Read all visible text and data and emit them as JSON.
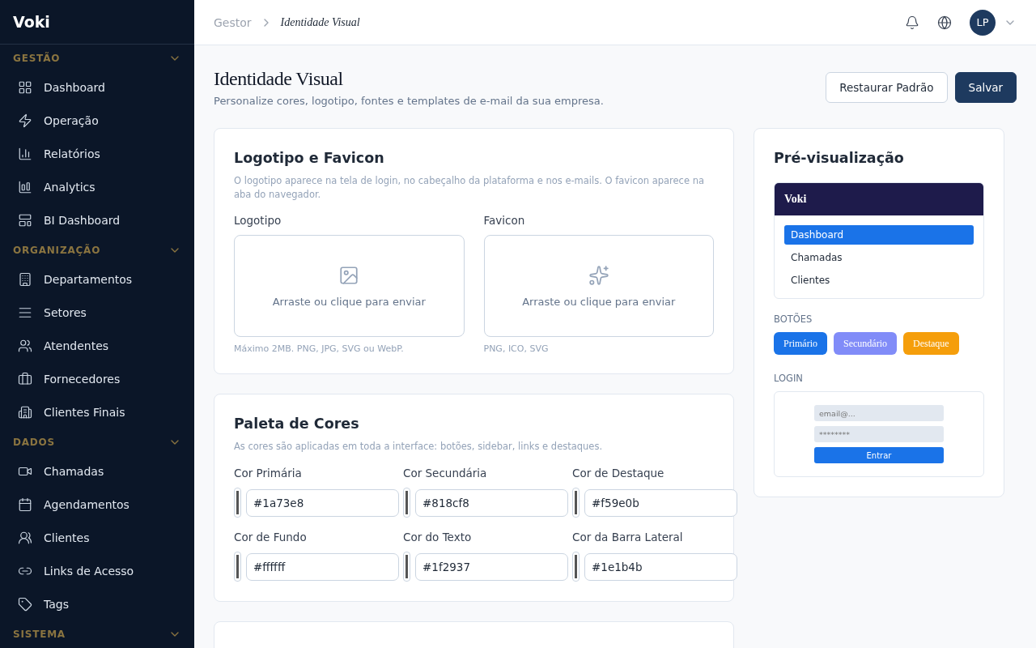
{
  "sidebar": {
    "brand": "Voki",
    "sections": [
      {
        "title": "GESTÃO",
        "expanded": true,
        "items": [
          {
            "label": "Dashboard"
          },
          {
            "label": "Operação"
          },
          {
            "label": "Relatórios"
          },
          {
            "label": "Analytics"
          },
          {
            "label": "BI Dashboard"
          }
        ]
      },
      {
        "title": "ORGANIZAÇÃO",
        "expanded": true,
        "items": [
          {
            "label": "Departamentos"
          },
          {
            "label": "Setores"
          },
          {
            "label": "Atendentes"
          },
          {
            "label": "Fornecedores"
          },
          {
            "label": "Clientes Finais"
          }
        ]
      },
      {
        "title": "DADOS",
        "expanded": true,
        "items": [
          {
            "label": "Chamadas"
          },
          {
            "label": "Agendamentos"
          },
          {
            "label": "Clientes"
          },
          {
            "label": "Links de Acesso"
          },
          {
            "label": "Tags"
          }
        ]
      },
      {
        "title": "SISTEMA",
        "expanded": true
      }
    ]
  },
  "breadcrumb": [
    "Gestor",
    "Identidade Visual"
  ],
  "user": {
    "initials": "LP"
  },
  "page": {
    "title": "Identidade Visual",
    "subtitle": "Personalize cores, logotipo, fontes e templates de e-mail da sua empresa.",
    "buttons": [
      {
        "label": "Restaurar Padrão",
        "kind": "secondary"
      },
      {
        "label": "Salvar",
        "kind": "primary"
      }
    ]
  },
  "logo_card": {
    "title": "Logotipo e Favicon",
    "description": "O logotipo aparece na tela de login, no cabeçalho da plataforma e nos e-mails. O favicon aparece na aba do navegador.",
    "uploads": [
      {
        "label": "Logotipo",
        "prompt": "Arraste ou clique para enviar",
        "hint": "Máximo 2MB. PNG, JPG, SVG ou WebP."
      },
      {
        "label": "Favicon",
        "prompt": "Arraste ou clique para enviar",
        "hint": "PNG, ICO, SVG"
      }
    ]
  },
  "palette_card": {
    "title": "Paleta de Cores",
    "description": "As cores são aplicadas em toda a interface: botões, sidebar, links e destaques.",
    "colors": [
      {
        "label": "Cor Primária",
        "value": "#1a73e8"
      },
      {
        "label": "Cor Secundária",
        "value": "#818cf8"
      },
      {
        "label": "Cor de Destaque",
        "value": "#f59e0b"
      },
      {
        "label": "Cor de Fundo",
        "value": "#ffffff"
      },
      {
        "label": "Cor do Texto",
        "value": "#1f2937"
      },
      {
        "label": "Cor da Barra Lateral",
        "value": "#1e1b4b"
      }
    ]
  },
  "preview": {
    "title": "Pré-visualização",
    "brand": "Voki",
    "nav": [
      {
        "label": "Dashboard",
        "selected": true
      },
      {
        "label": "Chamadas",
        "selected": false
      },
      {
        "label": "Clientes",
        "selected": false
      }
    ],
    "buttons_label": "BOTÕES",
    "buttons": [
      "Primário",
      "Secundário",
      "Destaque"
    ],
    "login_label": "LOGIN",
    "login": {
      "email_placeholder": "email@...",
      "password_placeholder": "********",
      "button": "Entrar"
    }
  }
}
